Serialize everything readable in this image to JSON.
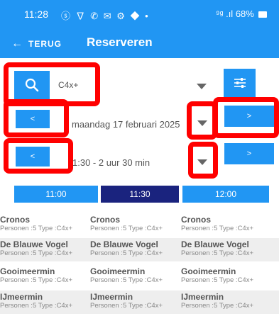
{
  "status_bar": {
    "time": "11:28",
    "icons": "ⓢ ∇ ✆ ✉ ⚙ ◆ •",
    "network": "⁹ᵍ .ıl",
    "battery": "68%"
  },
  "app_bar": {
    "back_label": "TERUG",
    "title": "Reserveren"
  },
  "search": {
    "value": "C4x+"
  },
  "date_row": {
    "label": "maandag 17 februari 2025",
    "prev_label": "<",
    "next_label": ">"
  },
  "time_row": {
    "label": "1:30 - 2 uur 30 min",
    "prev_label": "<",
    "next_label": ">"
  },
  "time_tabs": [
    {
      "label": "11:00",
      "selected": false
    },
    {
      "label": "11:30",
      "selected": true
    },
    {
      "label": "12:00",
      "selected": false
    }
  ],
  "boats": [
    {
      "name": "Cronos",
      "meta": "Personen :5 Type :C4x+"
    },
    {
      "name": "De Blauwe Vogel",
      "meta": "Personen :5 Type :C4x+"
    },
    {
      "name": "Gooimeermin",
      "meta": "Personen :5 Type :C4x+"
    },
    {
      "name": "IJmeermin",
      "meta": "Personen :5 Type :C4x+"
    }
  ],
  "colors": {
    "primary": "#2196f3",
    "selected_tab": "#1a237e",
    "highlight": "#ff0000"
  },
  "icons": [
    "search-icon",
    "filter-sliders-icon",
    "dropdown-caret-icon",
    "back-arrow-icon"
  ]
}
